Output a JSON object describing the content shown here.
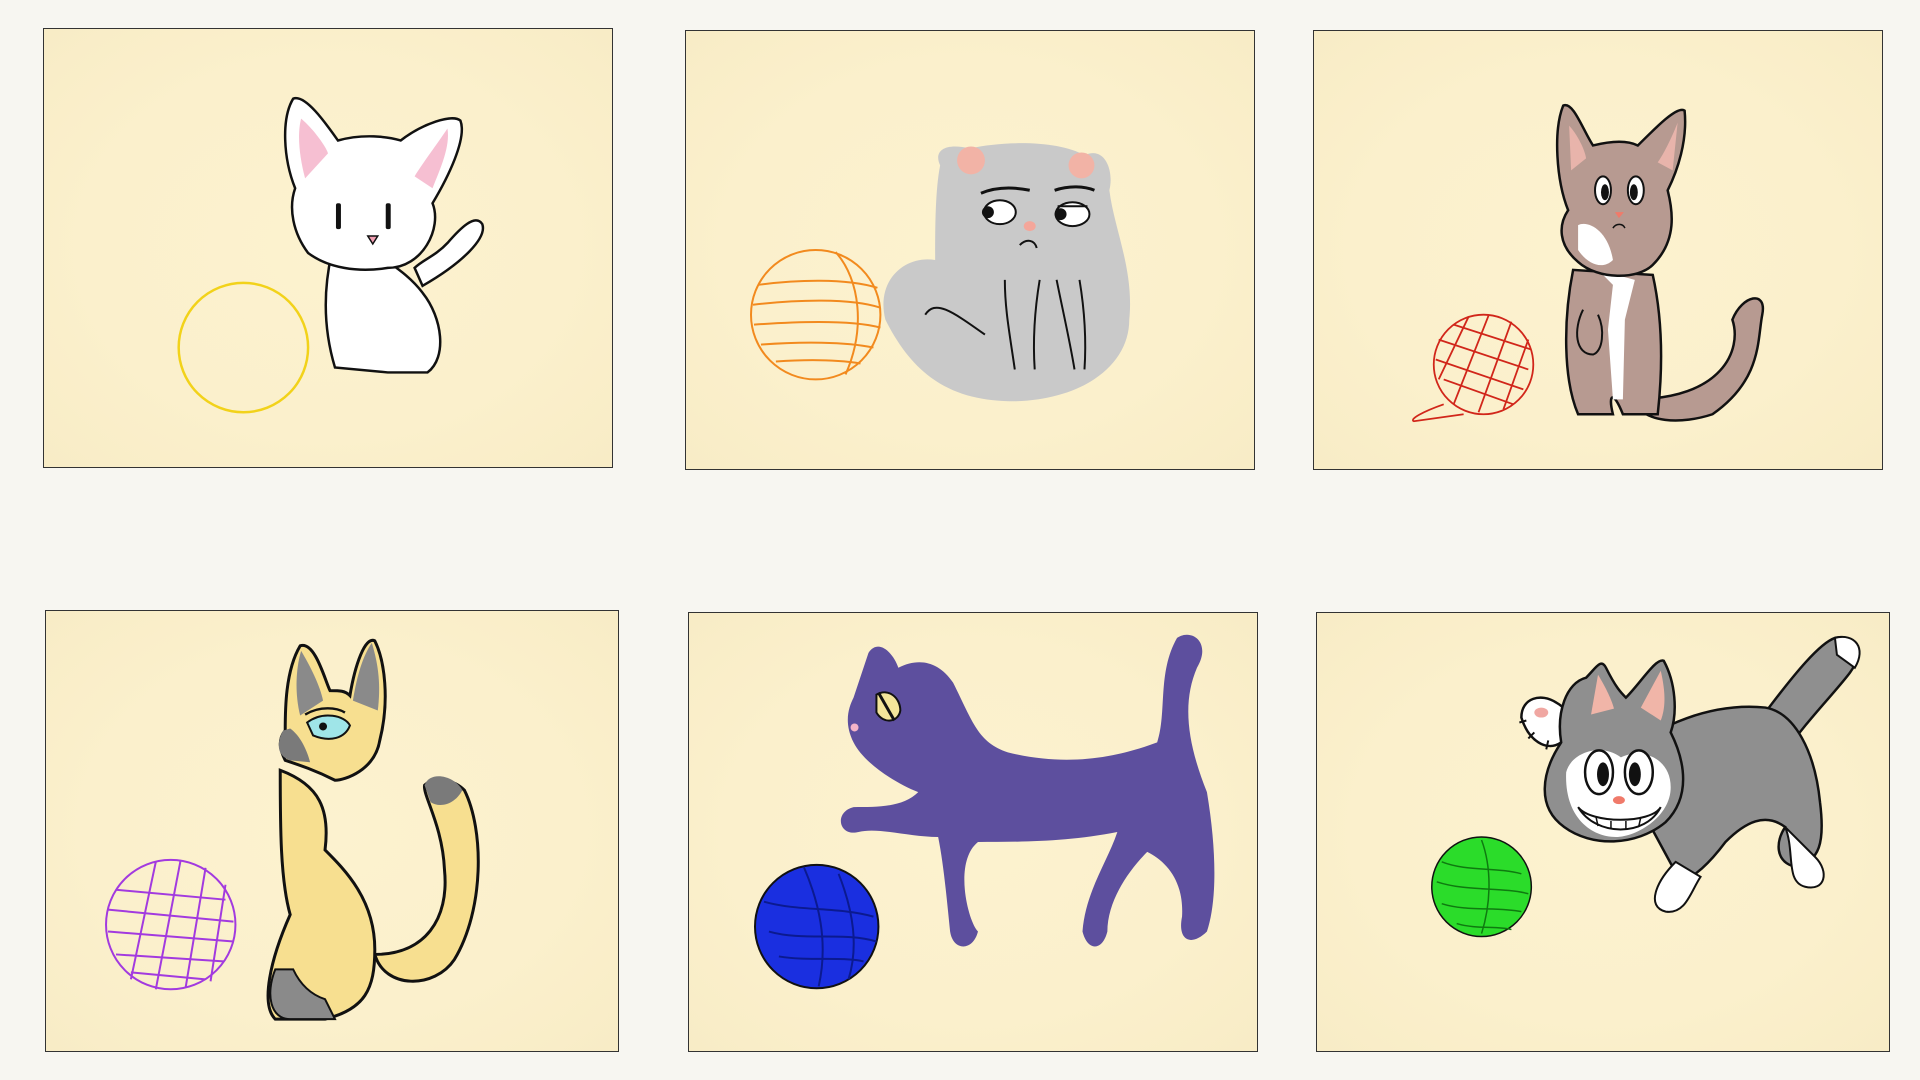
{
  "panels": [
    {
      "id": "white-cat-panel",
      "cat": "white-cat",
      "yarn_color": "#f2d21a"
    },
    {
      "id": "grey-cat-panel",
      "cat": "grey-cat",
      "yarn_color": "#f28a1e"
    },
    {
      "id": "brown-cat-panel",
      "cat": "brown-cat",
      "yarn_color": "#d1261a"
    },
    {
      "id": "siamese-cat-panel",
      "cat": "siamese-cat",
      "yarn_color": "#a23adf"
    },
    {
      "id": "purple-cat-panel",
      "cat": "purple-cat",
      "yarn_color": "#1a2fe0"
    },
    {
      "id": "tabby-cat-panel",
      "cat": "tabby-cat",
      "yarn_color": "#2bdc2a"
    }
  ],
  "colors": {
    "background": "#f7f6f1",
    "panel_fill": "#fbf0cc",
    "outline": "#111111"
  }
}
